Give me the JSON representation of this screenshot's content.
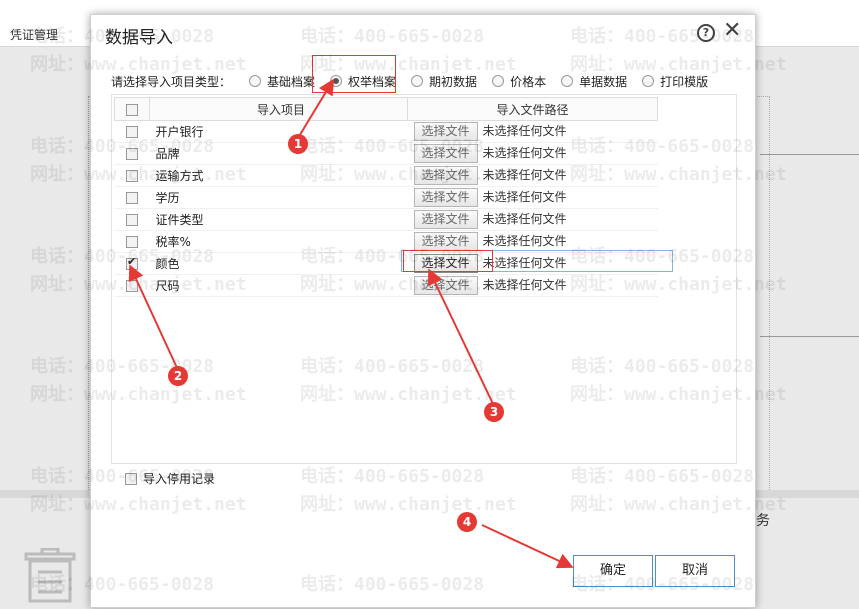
{
  "background": {
    "tab_label": "凭证管理",
    "side_text": "务"
  },
  "dialog": {
    "title": "数据导入",
    "help_icon": "?",
    "close_icon": "✕"
  },
  "type_selector": {
    "label": "请选择导入项目类型：",
    "options": [
      {
        "label": "基础档案",
        "selected": false
      },
      {
        "label": "权举档案",
        "selected": true
      },
      {
        "label": "期初数据",
        "selected": false
      },
      {
        "label": "价格本",
        "selected": false
      },
      {
        "label": "单据数据",
        "selected": false
      },
      {
        "label": "打印模版",
        "selected": false
      }
    ]
  },
  "grid": {
    "headers": {
      "item": "导入项目",
      "path": "导入文件路径"
    },
    "select_button": "选择文件",
    "no_file_text": "未选择任何文件",
    "rows": [
      {
        "label": "开户银行",
        "checked": false
      },
      {
        "label": "品牌",
        "checked": false
      },
      {
        "label": "运输方式",
        "checked": false
      },
      {
        "label": "学历",
        "checked": false
      },
      {
        "label": "证件类型",
        "checked": false
      },
      {
        "label": "税率%",
        "checked": false
      },
      {
        "label": "颜色",
        "checked": true
      },
      {
        "label": "尺码",
        "checked": false
      }
    ]
  },
  "import_disabled": {
    "label": "导入停用记录",
    "checked": false
  },
  "buttons": {
    "ok": "确定",
    "cancel": "取消"
  },
  "watermark": {
    "phone": "电话：400-665-0028",
    "site": "网址：www.chanjet.net"
  },
  "markers": [
    "1",
    "2",
    "3",
    "4"
  ],
  "colors": {
    "accent_red": "#e53935",
    "button_border": "#4a90c9"
  }
}
